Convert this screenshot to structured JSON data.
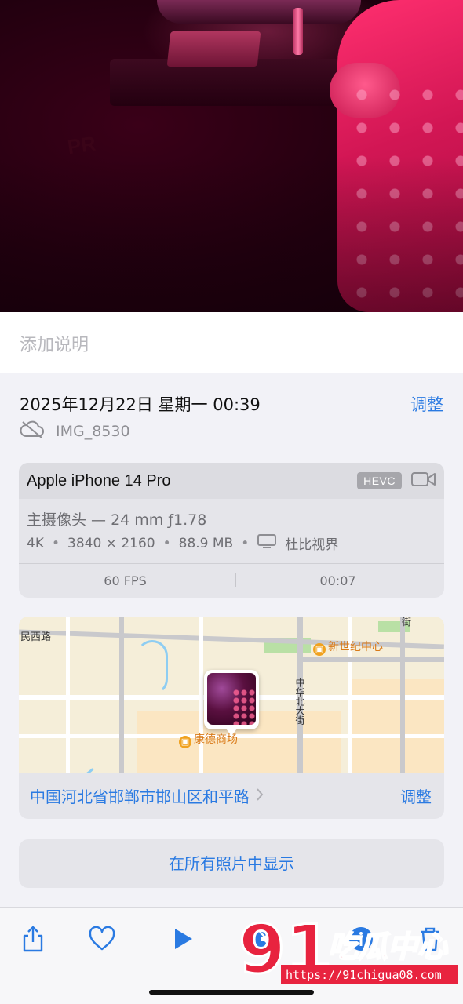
{
  "photo": {
    "name": "photo-preview"
  },
  "caption": {
    "placeholder": "添加说明"
  },
  "meta": {
    "date": "2025年12月22日 星期一 00:39",
    "adjust": "调整",
    "filename": "IMG_8530"
  },
  "device": {
    "model": "Apple iPhone 14 Pro",
    "codec": "HEVC",
    "lens": "主摄像头 — 24 mm ƒ1.78",
    "specs": [
      "4K",
      "3840 × 2160",
      "88.9 MB",
      "杜比视界"
    ],
    "fps": "60 FPS",
    "duration": "00:07"
  },
  "map": {
    "labels": {
      "road_west": "民西路",
      "poi_center": "新世纪中心",
      "poi_mall": "康德商场",
      "street": "中华北大街",
      "street_right": "街"
    },
    "address": "中国河北省邯郸市邯山区和平路",
    "adjust": "调整"
  },
  "show_all": "在所有照片中显示",
  "toolbar": {
    "icons": [
      "share-icon",
      "heart-icon",
      "play-icon",
      "mute-icon",
      "info-icon",
      "trash-icon"
    ]
  },
  "watermark": {
    "number": "91",
    "text": "吃瓜中心",
    "url": "https://91chigua08.com"
  },
  "colors": {
    "accent": "#2a7ae2",
    "background": "#f2f2f7"
  }
}
